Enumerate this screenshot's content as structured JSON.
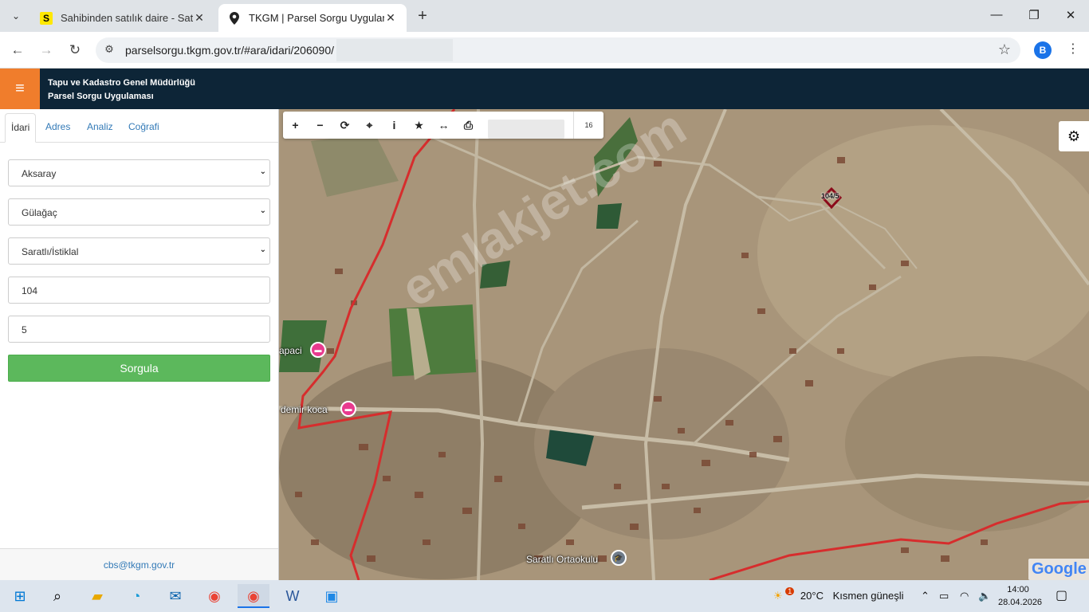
{
  "browser": {
    "tabs": [
      {
        "title": "Sahibinden satılık daire - Satılık",
        "favicon": "S"
      },
      {
        "title": "TKGM | Parsel Sorgu Uygulaması",
        "favicon": "location-pin"
      }
    ],
    "url": "parselsorgu.tkgm.gov.tr/#ara/idari/206090/",
    "profile_initial": "B"
  },
  "header": {
    "line1": "Tapu ve Kadastro Genel Müdürlüğü",
    "line2": "Parsel Sorgu Uygulaması"
  },
  "panel": {
    "tabs": [
      "İdari",
      "Adres",
      "Analiz",
      "Coğrafi"
    ],
    "province": "Aksaray",
    "district": "Gülağaç",
    "neighborhood": "Saratlı/İstiklal",
    "block": "104",
    "parcel": "5",
    "submit_label": "Sorgula",
    "footer_email": "cbs@tkgm.gov.tr"
  },
  "map": {
    "zoom": "16",
    "parcel_label": "104/5",
    "labels": {
      "place1": "apaci",
      "place2": "demir koca",
      "school": "Saratlı Ortaokulu"
    },
    "watermark": "emlakjet.com",
    "attribution": "Google",
    "colors": {
      "boundary": "#d62d2d",
      "parcel": "#8b0a1a"
    }
  },
  "taskbar": {
    "weather_temp": "20°C",
    "weather_text": "Kısmen güneşli",
    "weather_badge": "1",
    "time": "14:00",
    "date": "28.04.2026"
  }
}
